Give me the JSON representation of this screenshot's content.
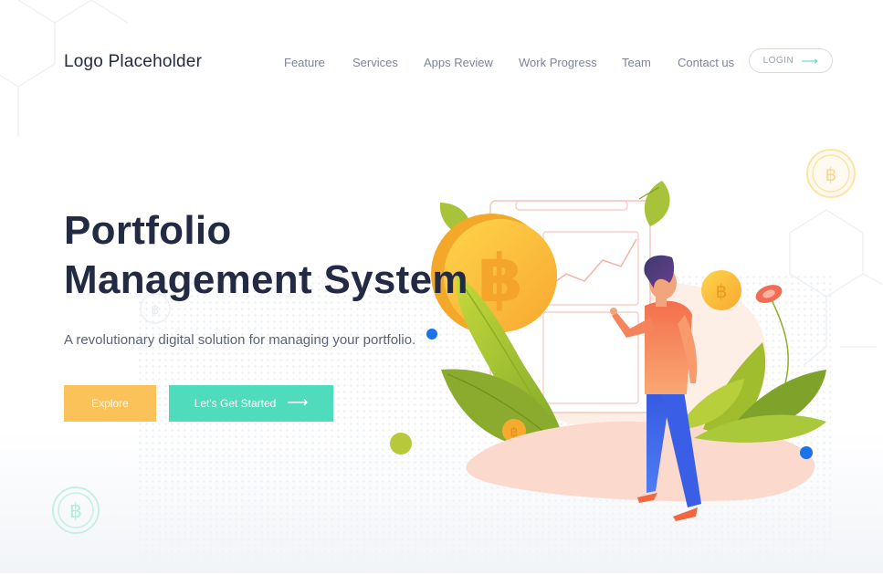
{
  "header": {
    "logo": "Logo Placeholder",
    "nav": [
      {
        "label": "Feature"
      },
      {
        "label": "Services"
      },
      {
        "label": "Apps Review"
      },
      {
        "label": "Work Progress"
      },
      {
        "label": "Team"
      },
      {
        "label": "Contact us"
      }
    ],
    "login_label": "LOGIN",
    "login_icon": "arrow-right-icon"
  },
  "hero": {
    "title_line1": "Portfolio",
    "title_line2": "Management System",
    "subtitle": "A revolutionary digital solution for managing your portfolio.",
    "explore_label": "Explore",
    "start_label": "Let's Get Started",
    "start_icon": "arrow-right-icon"
  },
  "illustration": {
    "coin_symbol": "฿",
    "icons": [
      "bitcoin-icon",
      "leaf-icon",
      "person-icon",
      "chart-icon",
      "flower-icon"
    ]
  },
  "colors": {
    "accent_yellow": "#fbc259",
    "accent_teal": "#4fdcbd",
    "text_dark": "#232b44",
    "text_muted": "#7d849a"
  }
}
